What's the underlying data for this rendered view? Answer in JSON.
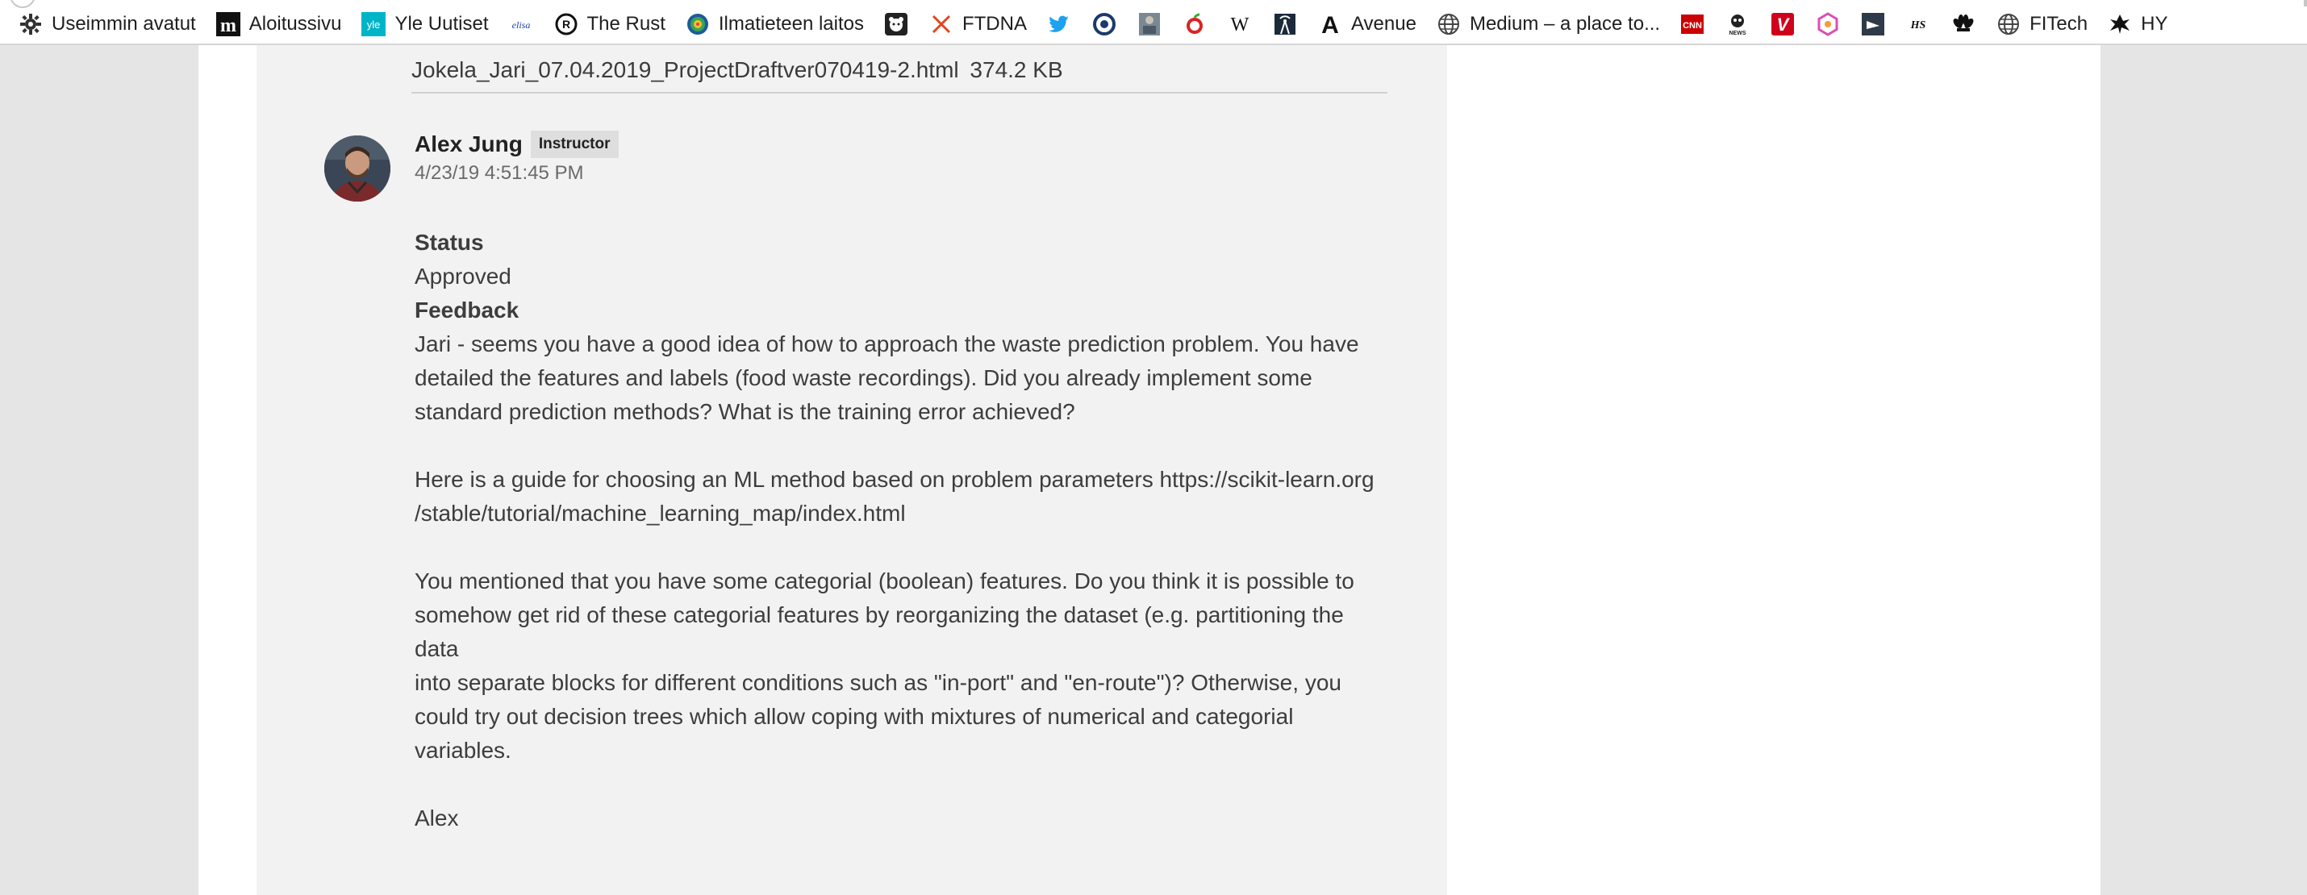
{
  "bookmarks": [
    {
      "label": "Useimmin avatut",
      "icon": "gear-icon"
    },
    {
      "label": "Aloitussivu",
      "icon": "m-logo-icon"
    },
    {
      "label": "Yle Uutiset",
      "icon": "yle-logo-icon"
    },
    {
      "label": "",
      "icon": "elisa-logo-icon"
    },
    {
      "label": "The Rust",
      "icon": "rust-logo-icon"
    },
    {
      "label": "Ilmatieteen laitos",
      "icon": "globe-pattern-icon"
    },
    {
      "label": "",
      "icon": "bear-logo-icon"
    },
    {
      "label": "FTDNA",
      "icon": "dna-logo-icon"
    },
    {
      "label": "",
      "icon": "twitter-bird-icon"
    },
    {
      "label": "",
      "icon": "circle-logo-icon"
    },
    {
      "label": "",
      "icon": "photo-thumbnail-icon"
    },
    {
      "label": "",
      "icon": "apple-logo-icon"
    },
    {
      "label": "",
      "icon": "wikipedia-w-icon"
    },
    {
      "label": "",
      "icon": "broadcast-tower-icon"
    },
    {
      "label": "Avenue",
      "icon": "letter-a-icon"
    },
    {
      "label": "Medium – a place to...",
      "icon": "globe-icon"
    },
    {
      "label": "",
      "icon": "cnn-logo-icon"
    },
    {
      "label": "",
      "icon": "news-logo-icon"
    },
    {
      "label": "",
      "icon": "v-logo-icon"
    },
    {
      "label": "",
      "icon": "hexagon-logo-icon"
    },
    {
      "label": "",
      "icon": "dark-tile-logo-icon"
    },
    {
      "label": "",
      "icon": "hs-logo-icon"
    },
    {
      "label": "",
      "icon": "nbc-peacock-icon"
    },
    {
      "label": "FITech",
      "icon": "globe-icon"
    },
    {
      "label": "HY",
      "icon": "hy-emblem-icon"
    }
  ],
  "attachment": {
    "filename": "Jokela_Jari_07.04.2019_ProjectDraftver070419-2.html",
    "size": "374.2 KB"
  },
  "post": {
    "author": "Alex Jung",
    "role": "Instructor",
    "date": "4/23/19 4:51:45 PM",
    "status_heading": "Status",
    "status_value": "Approved",
    "feedback_heading": "Feedback",
    "paragraph1_lines": [
      "Jari - seems you have a good idea of how to approach the waste prediction problem. You have",
      "detailed the features and labels (food waste recordings). Did you already implement some",
      "standard prediction methods? What is the training error achieved?"
    ],
    "paragraph2_line1_text": "Here is a guide for choosing an ML method based on problem parameters ",
    "paragraph2_link_part1": "https://scikit-learn.org",
    "paragraph2_link_part2": "/stable/tutorial/machine_learning_map/index.html",
    "paragraph3_lines": [
      "You mentioned that you have some categorial (boolean) features. Do you think it is possible to",
      "somehow get rid of these categorial features by reorganizing the dataset (e.g. partitioning the data",
      "into separate blocks for different conditions such as \"in-port\" and \"en-route\")? Otherwise, you",
      "could try out decision trees which allow coping with mixtures of numerical and categorial",
      "variables."
    ],
    "signature": "Alex"
  }
}
